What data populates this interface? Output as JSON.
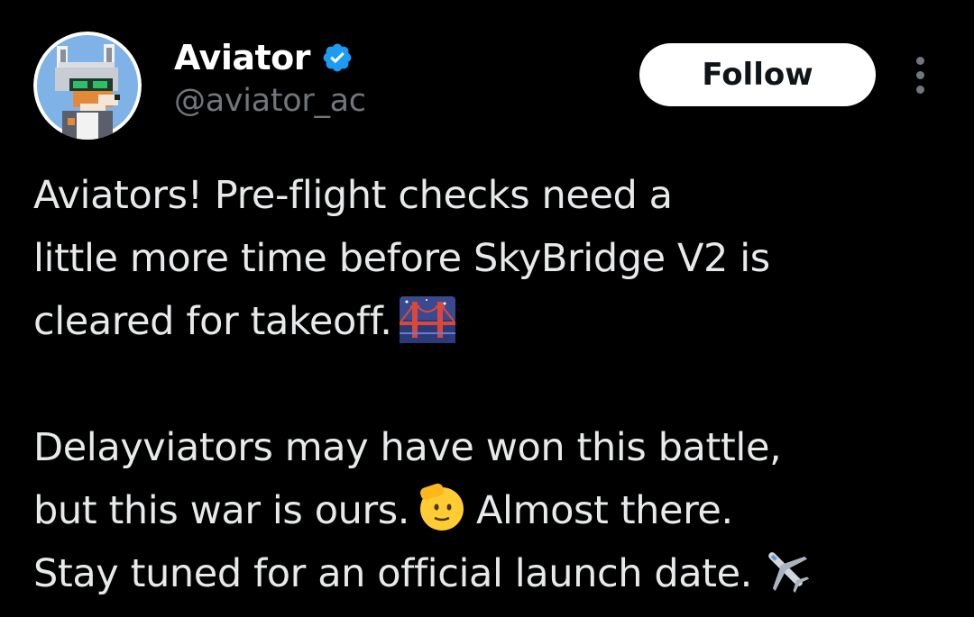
{
  "author": {
    "display_name": "Aviator",
    "handle": "@aviator_ac",
    "verified": true,
    "avatar": "pixel-fox-pilot-avatar"
  },
  "actions": {
    "follow_label": "Follow",
    "more_icon": "more-vertical-icon"
  },
  "tweet": {
    "paragraph_1": {
      "line_1": "Aviators! Pre-flight checks need a",
      "line_2": "little more time before SkyBridge V2 is",
      "line_3": "cleared for takeoff.",
      "emoji_1": "bridge-at-night-emoji"
    },
    "paragraph_2": {
      "line_1": "Delayviators may have won this battle,",
      "line_2a": "but this war is ours.",
      "emoji_2": "saluting-face-emoji",
      "line_2b": "Almost there.",
      "line_3": "Stay tuned for an official launch date.",
      "emoji_3": "airplane-emoji"
    }
  },
  "colors": {
    "background": "#000000",
    "text_primary": "#e7e9ea",
    "text_secondary": "#71767b",
    "verified_blue": "#1d9bf0",
    "follow_bg": "#ffffff"
  }
}
